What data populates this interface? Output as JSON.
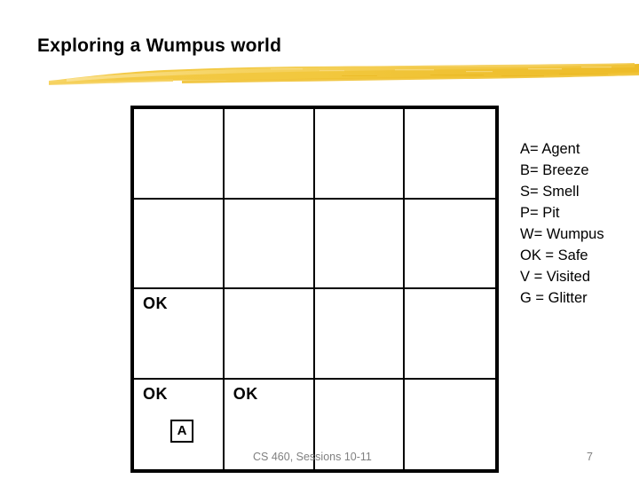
{
  "slide": {
    "title": "Exploring a Wumpus world",
    "accent_color": "#F0C53C",
    "grid_line_color": "#000000",
    "footer_color": "#808080"
  },
  "legend": {
    "lines": [
      "A= Agent",
      "B= Breeze",
      "S= Smell",
      "P= Pit",
      "W= Wumpus",
      "OK = Safe",
      "V = Visited",
      "G = Glitter"
    ]
  },
  "grid": {
    "rows": 4,
    "cols": 4,
    "cells": [
      [
        {
          "ok": "",
          "agent": ""
        },
        {
          "ok": "",
          "agent": ""
        },
        {
          "ok": "",
          "agent": ""
        },
        {
          "ok": "",
          "agent": ""
        }
      ],
      [
        {
          "ok": "",
          "agent": ""
        },
        {
          "ok": "",
          "agent": ""
        },
        {
          "ok": "",
          "agent": ""
        },
        {
          "ok": "",
          "agent": ""
        }
      ],
      [
        {
          "ok": "OK",
          "agent": ""
        },
        {
          "ok": "",
          "agent": ""
        },
        {
          "ok": "",
          "agent": ""
        },
        {
          "ok": "",
          "agent": ""
        }
      ],
      [
        {
          "ok": "OK",
          "agent": "A"
        },
        {
          "ok": "OK",
          "agent": ""
        },
        {
          "ok": "",
          "agent": ""
        },
        {
          "ok": "",
          "agent": ""
        }
      ]
    ]
  },
  "footer": {
    "course_text": "CS 460,  Sessions 10-11",
    "page_number": "7"
  }
}
